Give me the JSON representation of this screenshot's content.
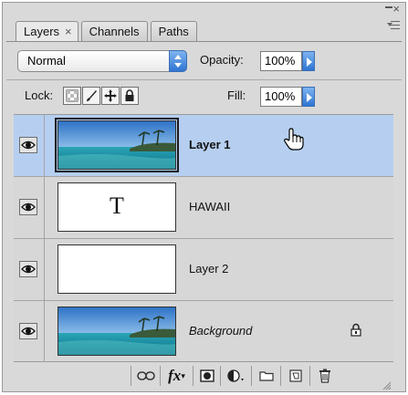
{
  "tabs": [
    {
      "label": "Layers",
      "close": "×"
    },
    {
      "label": "Channels"
    },
    {
      "label": "Paths"
    }
  ],
  "blend_mode": {
    "selected": "Normal"
  },
  "opacity": {
    "label": "Opacity:",
    "value": "100%"
  },
  "lock": {
    "label": "Lock:"
  },
  "fill": {
    "label": "Fill:",
    "value": "100%"
  },
  "layers": [
    {
      "name": "Layer 1",
      "thumb": "sea-image",
      "selected": true
    },
    {
      "name": "HAWAII",
      "thumb": "text",
      "thumb_glyph": "T"
    },
    {
      "name": "Layer 2",
      "thumb": "blank"
    },
    {
      "name": "Background",
      "thumb": "sea-image",
      "locked": true
    }
  ],
  "toolbar": {
    "fx_label": "fx",
    "icons": [
      "link-layers-icon",
      "layer-style-icon",
      "layer-mask-icon",
      "adjustment-layer-icon",
      "new-group-icon",
      "new-layer-icon",
      "trash-icon"
    ]
  },
  "colors": {
    "selection": "#b6cff0",
    "panel": "#d9d9d9",
    "accent": "#2f74d2"
  }
}
